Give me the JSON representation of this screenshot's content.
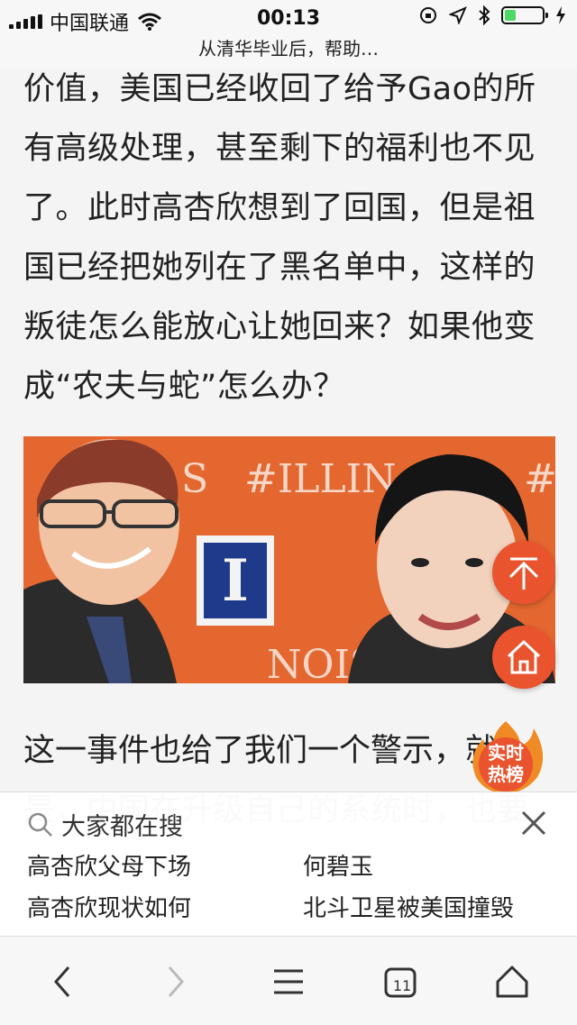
{
  "status_bar": {
    "carrier": "中国联通",
    "time": "00:13",
    "battery_level": 0.3
  },
  "page": {
    "title": "从清华毕业后，帮助…"
  },
  "article": {
    "paragraph_lines": [
      "价值，美国已经收回了给予Gao的所",
      "有高级处理，甚至剩下的福利也不见",
      "了。此时高杏欣想到了回国，但是祖",
      "国已经把她列在了黑名单中，这样的",
      "叛徒怎么能放心让她回来？如果他变",
      "成“农夫与蛇”怎么办？"
    ],
    "image": {
      "banner_text_top": "#ILLIN",
      "banner_text_left": "S",
      "banner_text_right": "#I",
      "logo_letter": "I",
      "banner_text_bottom": "NOIS"
    },
    "paragraph_2_line1": "这一事件也给了我们一个警示，",
    "paragraph_2_tail": "就",
    "paragraph_2_line2": "是，中国在升级自己的系统时，也要"
  },
  "hot_badge": {
    "line1": "实时",
    "line2": "热榜"
  },
  "search_panel": {
    "heading": "大家都在搜",
    "suggestions": [
      "高杏欣父母下场",
      "何碧玉",
      "高杏欣现状如何",
      "北斗卫星被美国撞毁"
    ]
  },
  "bottom_nav": {
    "tabs_count": "11"
  },
  "colors": {
    "accent": "#e9532d",
    "image_bg": "#e4672f"
  }
}
